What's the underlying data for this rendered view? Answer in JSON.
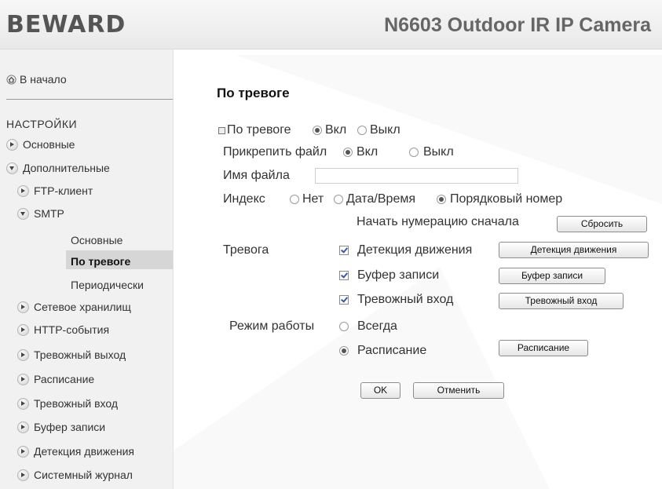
{
  "header": {
    "brand": "BEWARD",
    "model": "N6603 Outdoor IR IP Camera"
  },
  "sidebar": {
    "home": "В начало",
    "settings_title": "НАСТРОЙКИ",
    "items": [
      {
        "label": "Основные"
      },
      {
        "label": "Дополнительные"
      },
      {
        "label": "FTP-клиент"
      },
      {
        "label": "SMTP"
      },
      {
        "label": "Сетевое хранилищ"
      },
      {
        "label": "HTTP-события"
      },
      {
        "label": "Тревожный выход"
      },
      {
        "label": "Расписание"
      },
      {
        "label": "Тревожный вход"
      },
      {
        "label": "Буфер записи"
      },
      {
        "label": "Детекция движения"
      },
      {
        "label": "Системный журнал"
      }
    ],
    "smtp_sub": [
      {
        "label": "Основные"
      },
      {
        "label": "По тревоге"
      },
      {
        "label": "Периодически"
      }
    ],
    "active_sub": "По тревоге"
  },
  "main": {
    "title": "По тревоге",
    "on_alarm": {
      "label": "По тревоге",
      "on": "Вкл",
      "off": "Выкл",
      "value": "Вкл"
    },
    "attach_file": {
      "label": "Прикрепить файл",
      "on": "Вкл",
      "off": "Выкл",
      "value": "Вкл"
    },
    "file_name": {
      "label": "Имя файла",
      "value": ""
    },
    "index": {
      "label": "Индекс",
      "options": [
        "Нет",
        "Дата/Время",
        "Порядковый номер"
      ],
      "value": "Порядковый номер"
    },
    "restart_numbering": {
      "label": "Начать нумерацию сначала",
      "button": "Сбросить"
    },
    "alarm": {
      "label": "Тревога",
      "motion": {
        "label": "Детекция движения",
        "checked": true,
        "button": "Детекция движения"
      },
      "buffer": {
        "label": "Буфер записи",
        "checked": true,
        "button": "Буфер записи"
      },
      "input": {
        "label": "Тревожный вход",
        "checked": true,
        "button": "Тревожный вход"
      }
    },
    "mode": {
      "label": "Режим работы",
      "always": "Всегда",
      "schedule": "Расписание",
      "schedule_button": "Расписание",
      "value": "Расписание"
    },
    "ok_button": "OK",
    "cancel_button": "Отменить"
  }
}
